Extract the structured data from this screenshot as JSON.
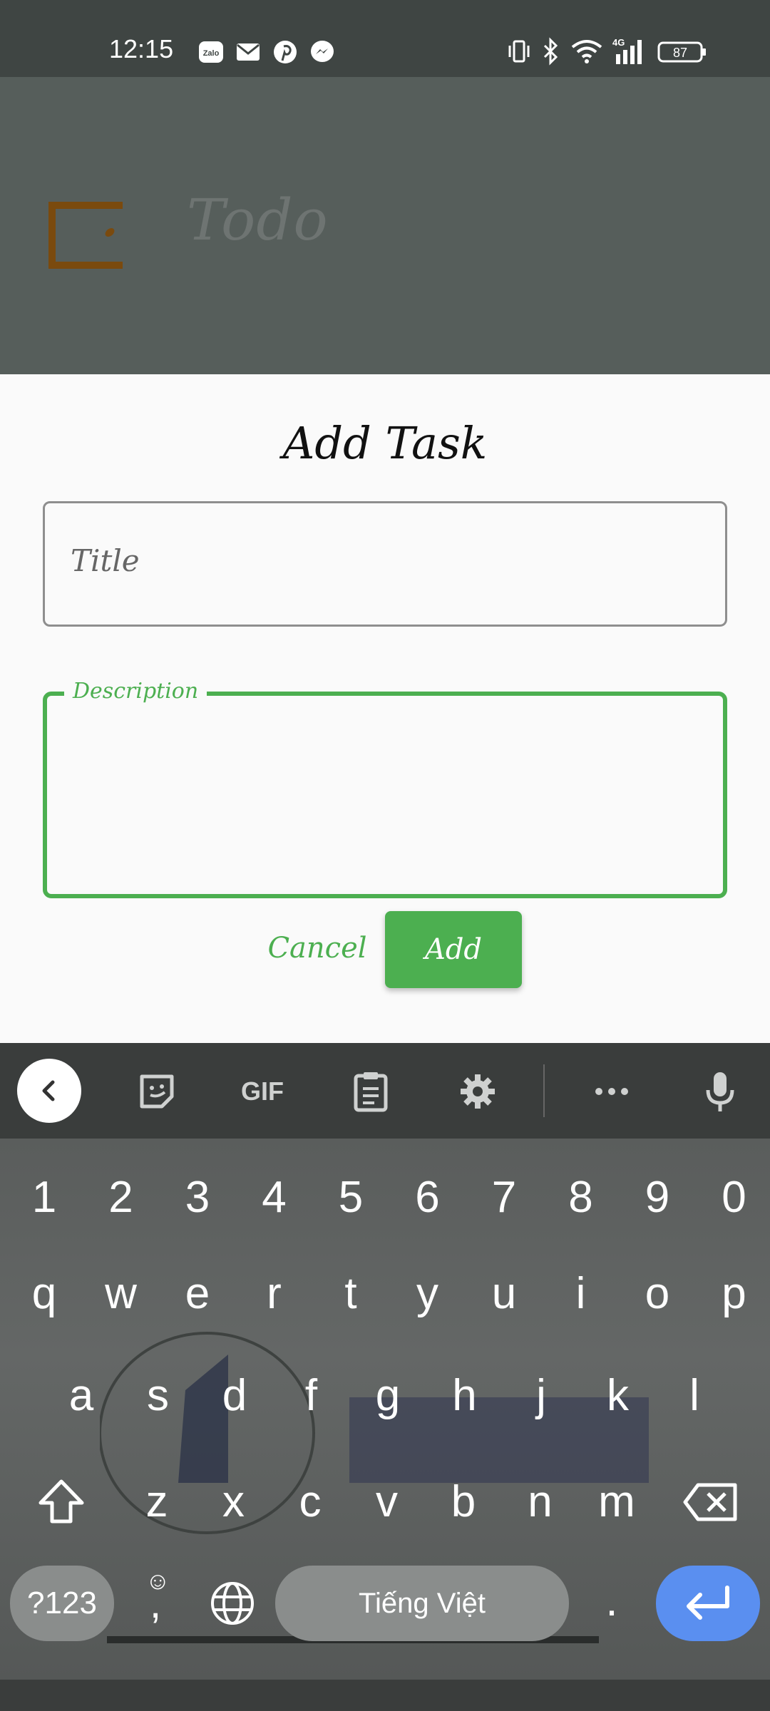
{
  "status_bar": {
    "time": "12:15",
    "notification_icons": [
      "zalo-icon",
      "mail-icon",
      "pinterest-icon",
      "messenger-icon"
    ],
    "battery": "87",
    "network": "4G"
  },
  "header": {
    "app_title": "Todo"
  },
  "dialog": {
    "title": "Add Task",
    "title_field": {
      "placeholder": "Title",
      "value": ""
    },
    "description_field": {
      "label": "Description",
      "value": ""
    },
    "cancel_label": "Cancel",
    "add_label": "Add",
    "accent_color": "#4caf50"
  },
  "keyboard": {
    "toolbar": {
      "gif_label": "GIF"
    },
    "number_row": [
      "1",
      "2",
      "3",
      "4",
      "5",
      "6",
      "7",
      "8",
      "9",
      "0"
    ],
    "row1": [
      "q",
      "w",
      "e",
      "r",
      "t",
      "y",
      "u",
      "i",
      "o",
      "p"
    ],
    "row2": [
      "a",
      "s",
      "d",
      "f",
      "g",
      "h",
      "j",
      "k",
      "l"
    ],
    "row3": [
      "z",
      "x",
      "c",
      "v",
      "b",
      "n",
      "m"
    ],
    "symbols_label": "?123",
    "comma_label": ",",
    "space_label": "Tiếng Việt",
    "period_label": "."
  }
}
